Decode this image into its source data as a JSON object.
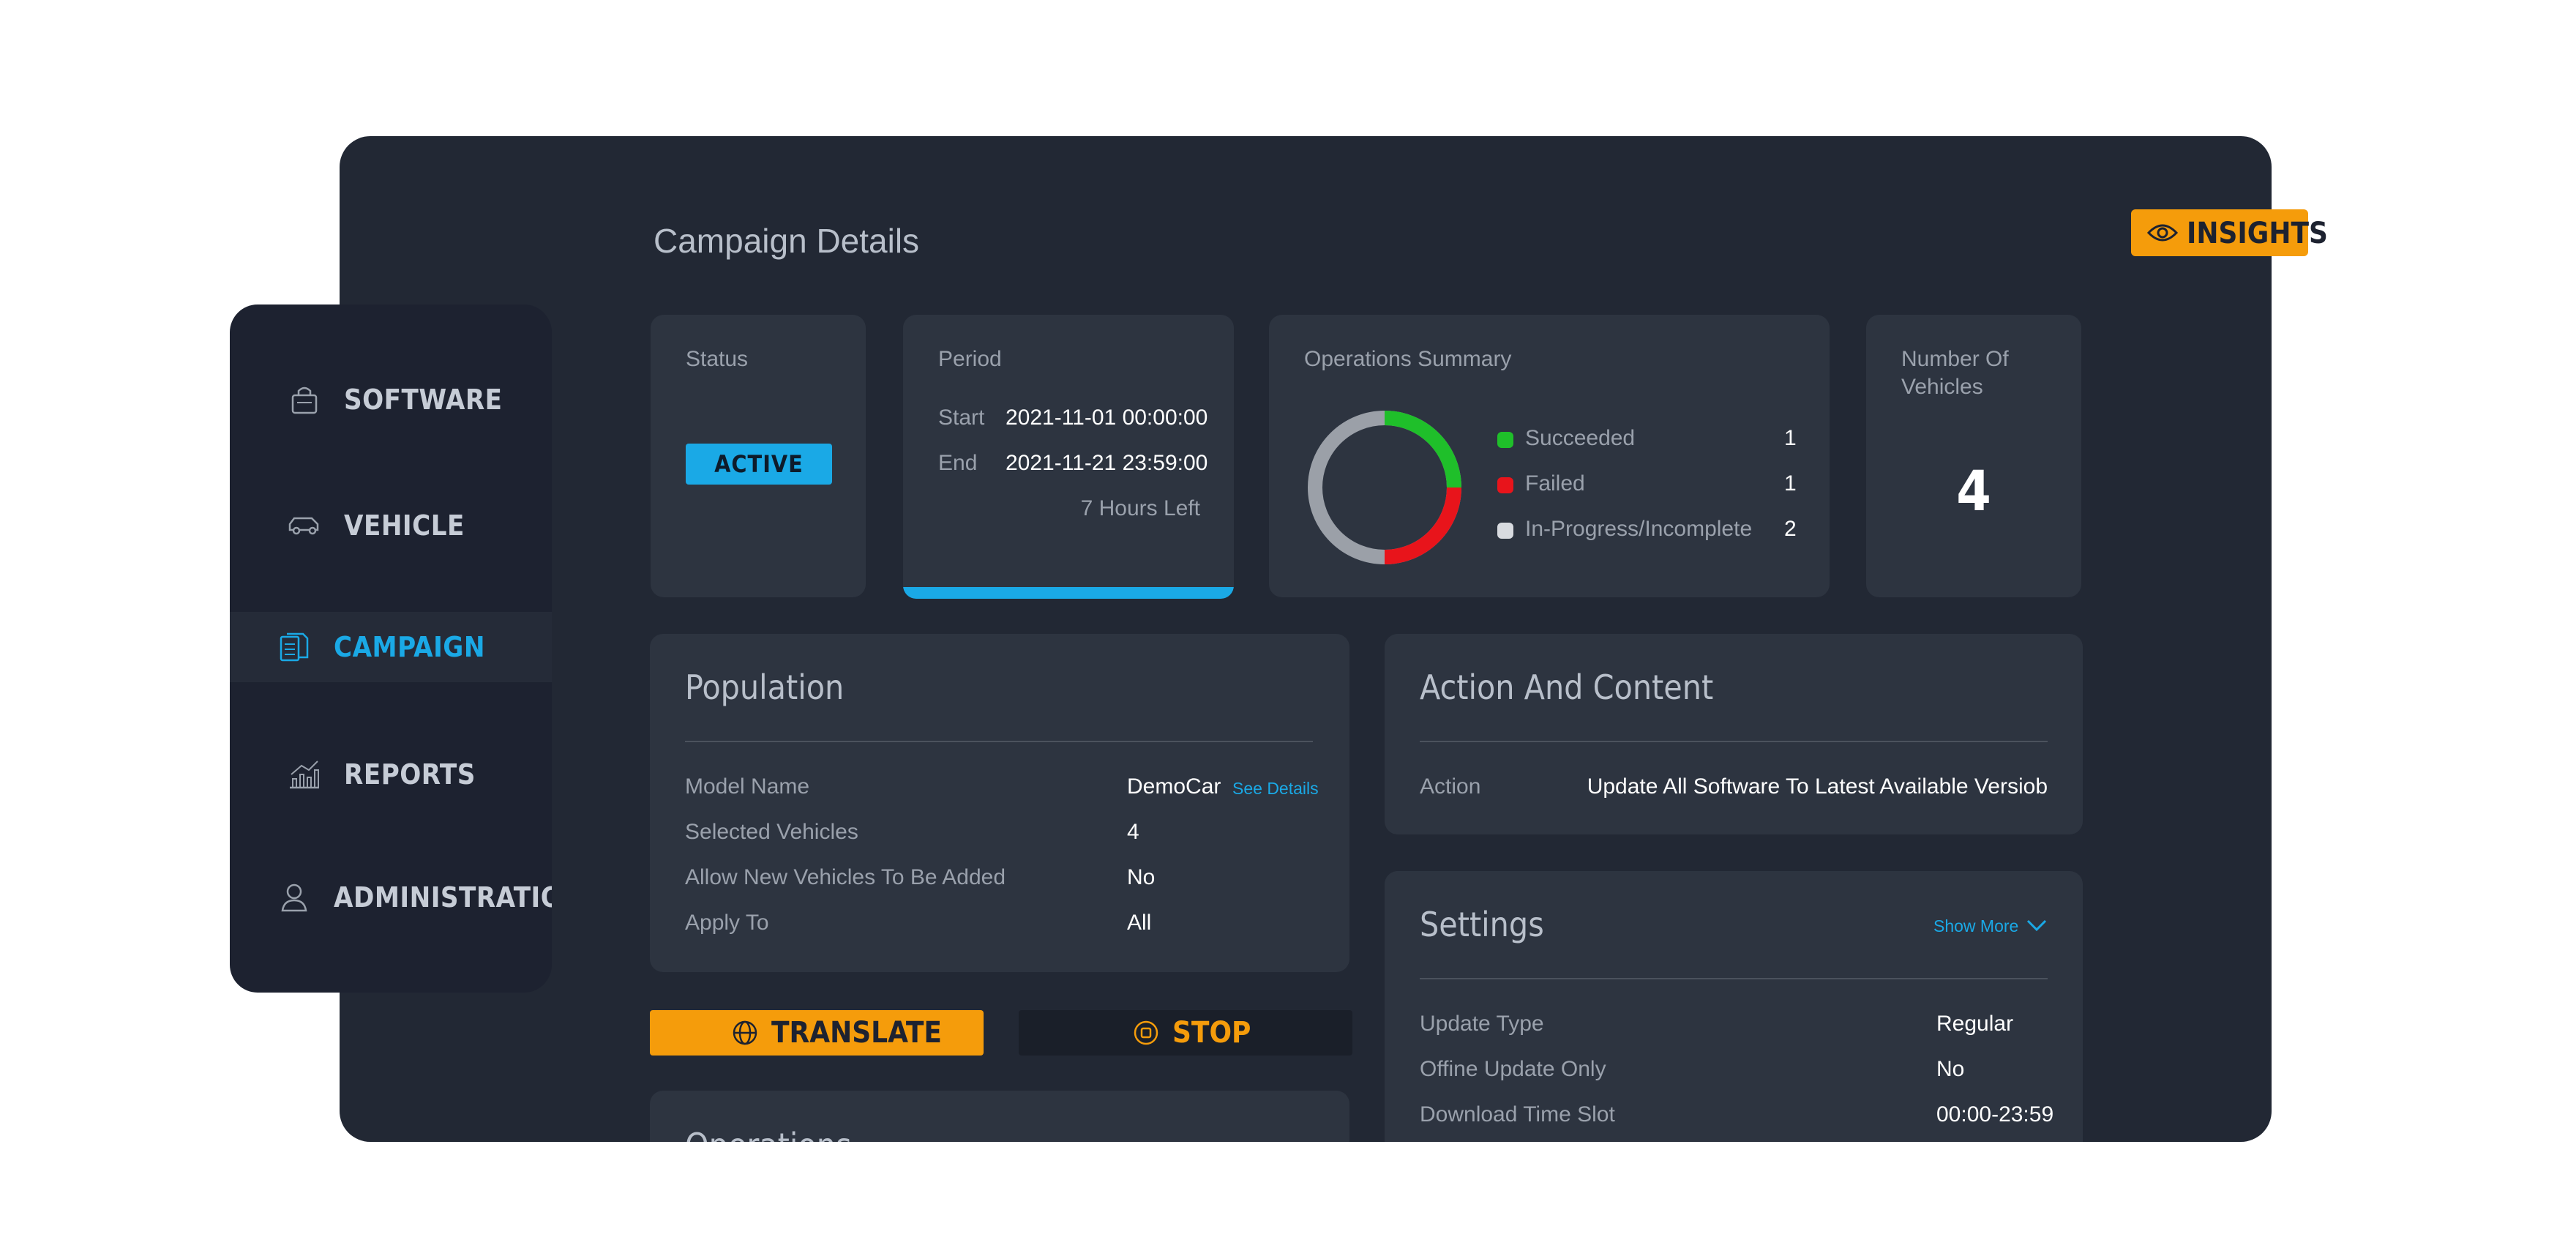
{
  "sidebar": {
    "items": [
      {
        "label": "SOFTWARE",
        "icon": "lock-package-icon"
      },
      {
        "label": "VEHICLE",
        "icon": "car-icon"
      },
      {
        "label": "CAMPAIGN",
        "icon": "document-icon"
      },
      {
        "label": "REPORTS",
        "icon": "chart-icon"
      },
      {
        "label": "ADMINISTRATION",
        "icon": "user-icon"
      }
    ],
    "active": "CAMPAIGN"
  },
  "header": {
    "title": "Campaign Details",
    "insights_label": "INSIGHTS"
  },
  "status_card": {
    "label": "Status",
    "value": "ACTIVE"
  },
  "period_card": {
    "label": "Period",
    "start_label": "Start",
    "start_value": "2021-11-01 00:00:00",
    "end_label": "End",
    "end_value": "2021-11-21 23:59:00",
    "remaining": "7 Hours Left",
    "progress": 1.0
  },
  "operations_summary": {
    "label": "Operations Summary",
    "items": [
      {
        "name": "Succeeded",
        "count": "1",
        "color": "#1fbf2a"
      },
      {
        "name": "Failed",
        "count": "1",
        "color": "#e8141b"
      },
      {
        "name": "In-Progress/Incomplete",
        "count": "2",
        "color": "#9ba0a8"
      }
    ]
  },
  "vehicles_card": {
    "label_line1": "Number Of",
    "label_line2": "Vehicles",
    "value": "4"
  },
  "population": {
    "title": "Population",
    "rows": [
      {
        "label": "Model Name",
        "value": "DemoCar"
      },
      {
        "label": "Selected Vehicles",
        "value": "4"
      },
      {
        "label": "Allow New Vehicles To Be Added",
        "value": "No"
      },
      {
        "label": "Apply To",
        "value": "All"
      }
    ],
    "see_details": "See Details"
  },
  "action_content": {
    "title": "Action And Content",
    "action_label": "Action",
    "action_value": "Update All Software To Latest Available Versiob"
  },
  "settings": {
    "title": "Settings",
    "show_more": "Show More",
    "rows": [
      {
        "label": "Update Type",
        "value": "Regular"
      },
      {
        "label": "Offine Update Only",
        "value": "No"
      },
      {
        "label": "Download Time Slot",
        "value": "00:00-23:59"
      }
    ]
  },
  "buttons": {
    "translate": "TRANSLATE",
    "stop": "STOP"
  },
  "operations": {
    "title": "Operations"
  },
  "colors": {
    "accent_blue": "#1aa9e6",
    "accent_orange": "#f59c0b",
    "panel": "#2d3440",
    "background": "#222834"
  }
}
